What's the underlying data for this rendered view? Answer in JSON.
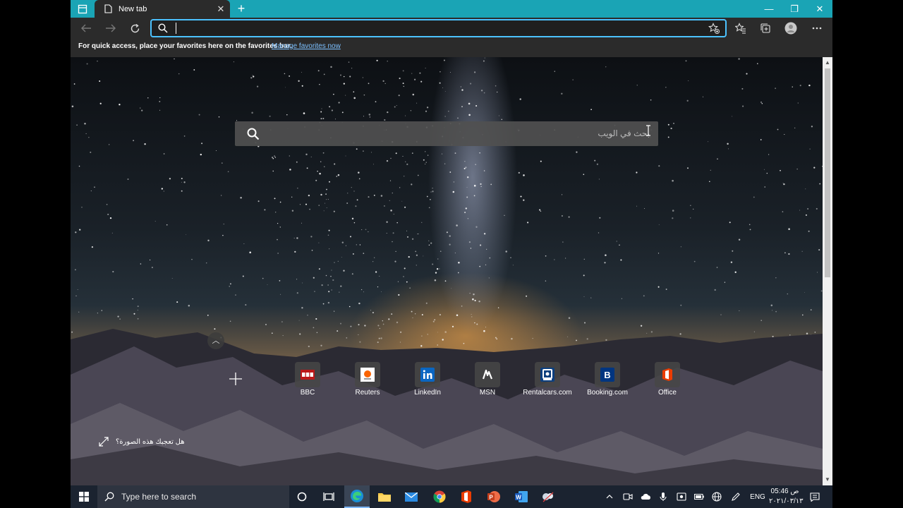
{
  "browser": {
    "tab": {
      "title": "New tab"
    },
    "favorites_bar": {
      "message": "For quick access, place your favorites here on the favorites bar.",
      "link": "Manage favorites now"
    }
  },
  "newtab": {
    "search_placeholder": "بحث في الويب",
    "quick_links": [
      {
        "label": "BBC",
        "icon": "bbc-icon"
      },
      {
        "label": "Reuters",
        "icon": "reuters-icon"
      },
      {
        "label": "LinkedIn",
        "icon": "linkedin-icon"
      },
      {
        "label": "MSN",
        "icon": "msn-icon"
      },
      {
        "label": "Rentalcars.com",
        "icon": "rentalcars-icon"
      },
      {
        "label": "Booking.com",
        "icon": "booking-icon"
      },
      {
        "label": "Office",
        "icon": "office-icon"
      }
    ],
    "feedback_text": "هل تعجبك هذه الصورة؟"
  },
  "taskbar": {
    "search_placeholder": "Type here to search",
    "language": "ENG",
    "time": "05:46 ص",
    "date": "٢٠٢١/٠٣/١٣"
  },
  "colors": {
    "title_bar": "#1aa4b5",
    "accent": "#4cc2ff",
    "taskbar": "#1b2330"
  }
}
